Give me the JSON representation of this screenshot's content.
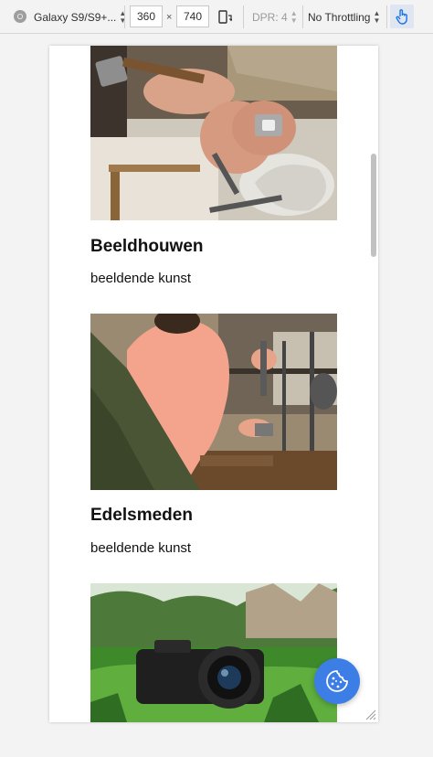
{
  "toolbar": {
    "device": "Galaxy S9/S9+...",
    "width": "360",
    "times": "×",
    "height": "740",
    "dpr": "DPR: 4",
    "throttle": "No Throttling"
  },
  "cards": [
    {
      "title": "Beeldhouwen",
      "subtitle": "beeldende kunst"
    },
    {
      "title": "Edelsmeden",
      "subtitle": "beeldende kunst"
    },
    {
      "title": "",
      "subtitle": ""
    }
  ],
  "colors": {
    "accent": "#3d7ee6",
    "touch_active": "#1a73e8"
  },
  "icons": {
    "browser": "chrome-icon",
    "rotate": "rotate-icon",
    "touch": "touch-hand-icon",
    "cookie": "cookie-icon"
  }
}
